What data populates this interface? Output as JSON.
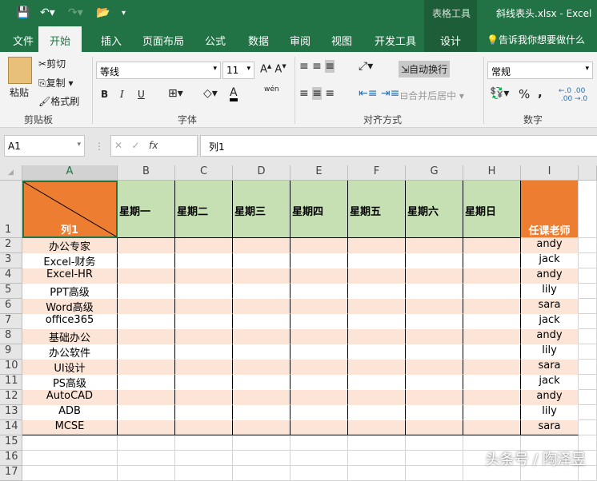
{
  "title": {
    "context_tab": "表格工具",
    "filename": "斜线表头.xlsx  -  Excel"
  },
  "tabs": [
    "文件",
    "开始",
    "插入",
    "页面布局",
    "公式",
    "数据",
    "审阅",
    "视图",
    "开发工具",
    "设计"
  ],
  "tell_me": "告诉我你想要做什么",
  "ribbon": {
    "paste": "粘贴",
    "cut": "剪切",
    "copy": "复制",
    "format_painter": "格式刷",
    "clipboard": "剪贴板",
    "font_name": "等线",
    "font_size": "11",
    "font_group": "字体",
    "bold": "B",
    "italic": "I",
    "underline": "U",
    "wrap": "自动换行",
    "merge": "合并后居中",
    "align_group": "对齐方式",
    "number_format": "常规",
    "percent": "%",
    "comma": ",",
    "number_group": "数字",
    "phonetic": "wén"
  },
  "formula_bar": {
    "name_box": "A1",
    "fx": "fx",
    "value": "列1"
  },
  "columns": [
    "A",
    "B",
    "C",
    "D",
    "E",
    "F",
    "G",
    "H",
    "I"
  ],
  "header_row": {
    "a1": "列1",
    "days": [
      "星期一",
      "星期二",
      "星期三",
      "星期四",
      "星期五",
      "星期六",
      "星期日"
    ],
    "teacher": "任课老师"
  },
  "rows": [
    [
      "办公专家",
      "andy"
    ],
    [
      "Excel-财务",
      "jack"
    ],
    [
      "Excel-HR",
      "andy"
    ],
    [
      "PPT高级",
      "lily"
    ],
    [
      "Word高级",
      "sara"
    ],
    [
      "office365",
      "jack"
    ],
    [
      "基础办公",
      "andy"
    ],
    [
      "办公软件",
      "lily"
    ],
    [
      "UI设计",
      "sara"
    ],
    [
      "PS高级",
      "jack"
    ],
    [
      "AutoCAD",
      "andy"
    ],
    [
      "ADB",
      "lily"
    ],
    [
      "MCSE",
      "sara"
    ]
  ],
  "row_numbers": [
    "1",
    "2",
    "3",
    "4",
    "5",
    "6",
    "7",
    "8",
    "9",
    "10",
    "11",
    "12",
    "13",
    "14",
    "15",
    "16",
    "17"
  ],
  "colors": {
    "green": "#217346",
    "orange": "#ed7d31",
    "light_green": "#c6e0b4",
    "peach": "#fce4d6"
  },
  "watermark": "头条号 / 陶泽昱"
}
